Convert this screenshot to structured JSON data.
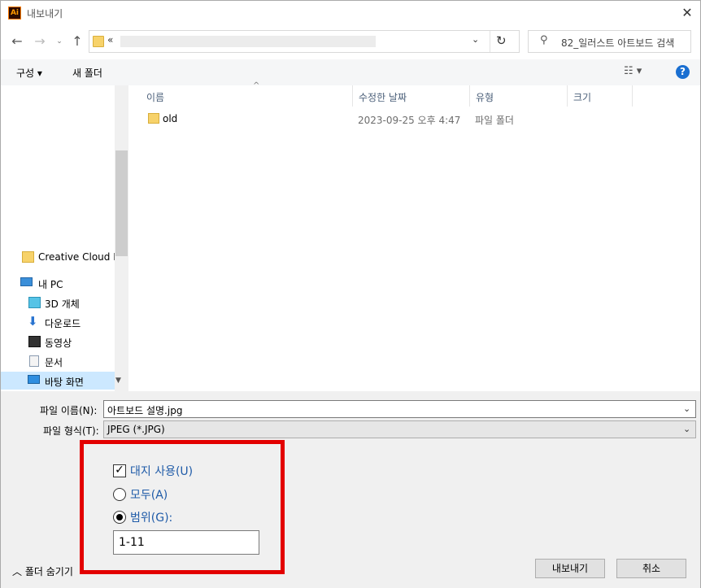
{
  "window": {
    "title": "내보내기",
    "app_icon_text": "Ai"
  },
  "address": {
    "chevron": "«",
    "search_placeholder": "82_일러스트 아트보드 검색"
  },
  "toolbar": {
    "organize": "구성 ▾",
    "new_folder": "새 폴더",
    "help": "?"
  },
  "nav": {
    "items": [
      {
        "label": "Creative Cloud Fil",
        "icon": "creative-cloud-icon"
      },
      {
        "label": "내 PC",
        "icon": "computer-icon"
      },
      {
        "label": "3D 개체",
        "icon": "3d-objects-icon"
      },
      {
        "label": "다운로드",
        "icon": "download-icon"
      },
      {
        "label": "동영상",
        "icon": "video-icon"
      },
      {
        "label": "문서",
        "icon": "document-icon"
      },
      {
        "label": "바탕 화면",
        "icon": "desktop-icon"
      }
    ]
  },
  "filelist": {
    "columns": [
      "이름",
      "수정한 날짜",
      "유형",
      "크기"
    ],
    "rows": [
      {
        "name": "old",
        "date": "2023-09-25 오후 4:47",
        "type": "파일 폴더",
        "size": ""
      }
    ]
  },
  "form": {
    "filename_label": "파일 이름(N):",
    "filename_value": "아트보드 설명.jpg",
    "filetype_label": "파일 형식(T):",
    "filetype_value": "JPEG (*.JPG)"
  },
  "options": {
    "use_artboards": "대지 사용(U)",
    "all": "모두(A)",
    "range": "범위(G):",
    "range_value": "1-11"
  },
  "footer": {
    "hide_folders": "폴더 숨기기",
    "export_button": "내보내기",
    "cancel_button": "취소"
  },
  "colors": {
    "highlight_box": "#e30000",
    "option_text": "#1f5ba8",
    "selected_nav": "#cce8ff"
  }
}
